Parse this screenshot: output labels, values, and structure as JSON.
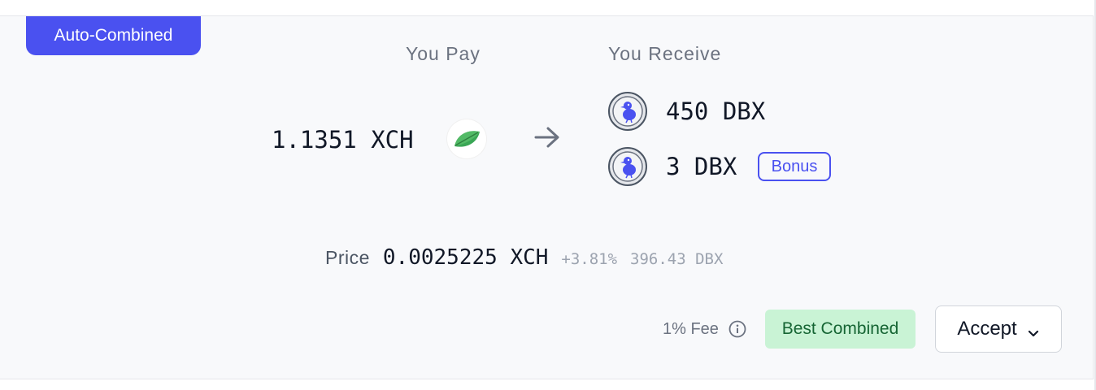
{
  "card": {
    "badge_label": "Auto-Combined"
  },
  "pay": {
    "label": "You Pay",
    "amount": "1.1351 XCH",
    "token_icon": "chia-leaf-icon"
  },
  "receive": {
    "label": "You Receive",
    "items": [
      {
        "amount": "450 DBX",
        "token_icon": "dodo-coin-icon"
      },
      {
        "amount": "3 DBX",
        "token_icon": "dodo-coin-icon",
        "badge": "Bonus"
      }
    ]
  },
  "price": {
    "label": "Price",
    "value": "0.0025225 XCH",
    "change": "+3.81%",
    "inverse": "396.43 DBX"
  },
  "footer": {
    "fee_text": "1% Fee",
    "status_badge": "Best Combined",
    "accept_label": "Accept"
  },
  "colors": {
    "accent": "#4a51f0",
    "success_bg": "#c9f3d5",
    "success_text": "#166534",
    "muted": "#9ca3af"
  }
}
